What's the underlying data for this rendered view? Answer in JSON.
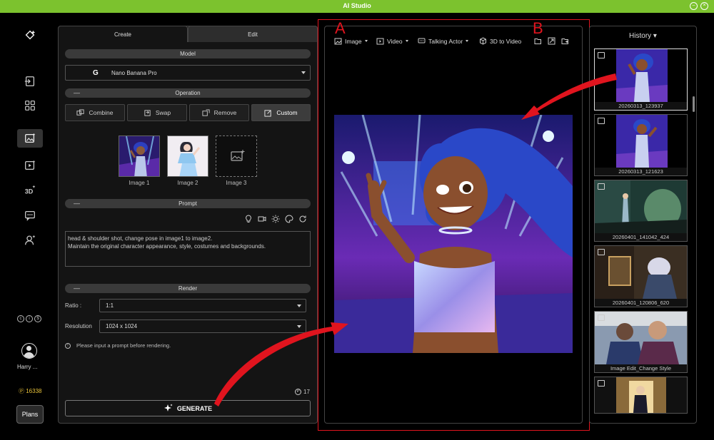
{
  "window": {
    "title": "AI Studio"
  },
  "user": {
    "name": "Harry ...",
    "points": "16338",
    "plans_label": "Plans"
  },
  "tabs": [
    {
      "label": "Create"
    },
    {
      "label": "Edit"
    }
  ],
  "model": {
    "section": "Model",
    "selected": "Nano Banana Pro"
  },
  "operation": {
    "section": "Operation",
    "buttons": [
      {
        "label": "Combine",
        "icon": "combine-icon"
      },
      {
        "label": "Swap",
        "icon": "swap-icon"
      },
      {
        "label": "Remove",
        "icon": "remove-icon"
      },
      {
        "label": "Custom",
        "icon": "custom-icon"
      }
    ],
    "images": [
      {
        "label": "Image 1"
      },
      {
        "label": "Image 2"
      },
      {
        "label": "Image 3"
      }
    ]
  },
  "prompt": {
    "section": "Prompt",
    "line1": "head & shoulder shot, change pose in image1 to image2.",
    "line2": "Maintain the original character appearance, style, costumes and backgrounds."
  },
  "render": {
    "section": "Render",
    "ratio_label": "Ratio :",
    "ratio_value": "1:1",
    "resolution_label": "Resolution",
    "resolution_value": "1024 x 1024",
    "hint": "Please input a prompt before rendering.",
    "cost": "17",
    "generate_label": "GENERATE"
  },
  "center_toolbar": {
    "image": "Image",
    "video": "Video",
    "talking_actor": "Talking Actor",
    "three_d": "3D to Video"
  },
  "annotations": {
    "a": "A",
    "b": "B"
  },
  "history": {
    "title": "History",
    "items": [
      {
        "caption": "20260313_123937"
      },
      {
        "caption": "20260313_121623"
      },
      {
        "caption": "20260401_141042_424"
      },
      {
        "caption": "20260401_120806_620"
      },
      {
        "caption": "Image Edit_Change Style"
      },
      {
        "caption": ""
      }
    ]
  },
  "colors": {
    "accent_green": "#7cc22e",
    "annotation_red": "#e0141e",
    "points_gold": "#e8c23a"
  }
}
